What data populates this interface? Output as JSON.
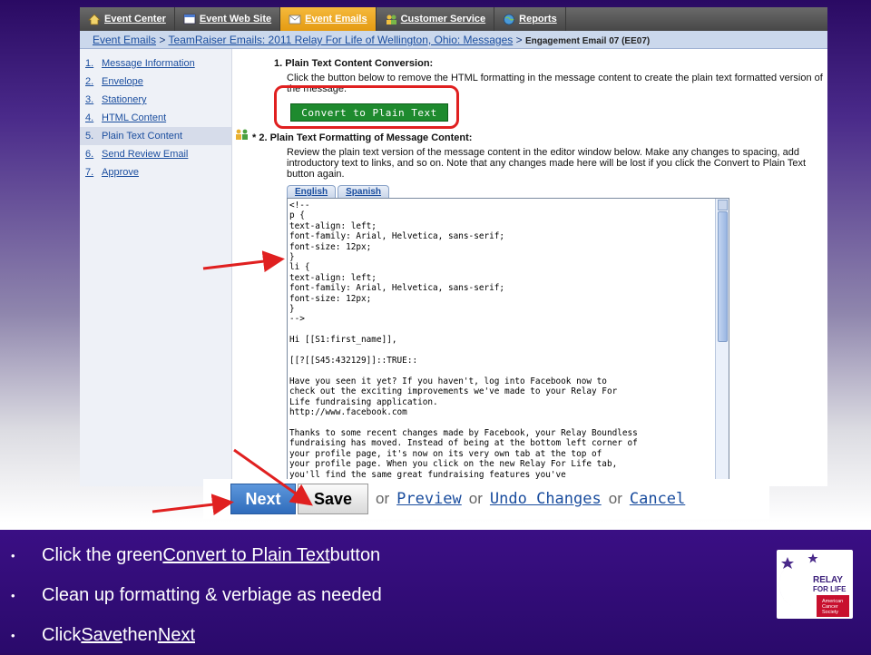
{
  "topnav": {
    "items": [
      {
        "label": "Event Center",
        "icon": "home-icon",
        "active": false
      },
      {
        "label": "Event Web Site",
        "icon": "website-icon",
        "active": false
      },
      {
        "label": "Event Emails",
        "icon": "envelope-icon",
        "active": true
      },
      {
        "label": "Customer Service",
        "icon": "people-icon",
        "active": false
      },
      {
        "label": "Reports",
        "icon": "globe-icon",
        "active": false
      }
    ]
  },
  "breadcrumb": {
    "link1": "Event Emails",
    "sep": ">",
    "link2": "TeamRaiser Emails: 2011 Relay For Life of Wellington, Ohio: Messages",
    "current": "Engagement Email 07 (EE07)"
  },
  "sidebar": {
    "steps": [
      {
        "num": "1.",
        "label": "Message Information"
      },
      {
        "num": "2.",
        "label": "Envelope"
      },
      {
        "num": "3.",
        "label": "Stationery"
      },
      {
        "num": "4.",
        "label": "HTML Content"
      },
      {
        "num": "5.",
        "label": "Plain Text Content"
      },
      {
        "num": "6.",
        "label": "Send Review Email"
      },
      {
        "num": "7.",
        "label": "Approve"
      }
    ]
  },
  "section1": {
    "title": "1.  Plain Text Content Conversion:",
    "text": "Click the button below to remove the HTML formatting in the message content to create the plain text formatted version of the message.",
    "button": "Convert to Plain Text"
  },
  "section2": {
    "title": "* 2.  Plain Text Formatting of Message Content:",
    "text": "Review the plain text version of the message content in the editor window below. Make any changes to spacing, add introductory text to links, and so on. Note that any changes made here will be lost if you click the Convert to Plain Text button again.",
    "tabs": [
      "English",
      "Spanish"
    ]
  },
  "editor": {
    "content": "<!--\np {\ntext-align: left;\nfont-family: Arial, Helvetica, sans-serif;\nfont-size: 12px;\n}\nli {\ntext-align: left;\nfont-family: Arial, Helvetica, sans-serif;\nfont-size: 12px;\n}\n-->\n\nHi [[S1:first_name]],\n\n[[?[[S45:432129]]::TRUE::\n\nHave you seen it yet? If you haven't, log into Facebook now to\ncheck out the exciting improvements we've made to your Relay For\nLife fundraising application.\nhttp://www.facebook.com\n\nThanks to some recent changes made by Facebook, your Relay Boundless\nfundraising has moved. Instead of being at the bottom left corner of\nyour profile page, it's now on its very own tab at the top of\nyour profile page. When you click on the new Relay For Life tab,\nyou'll find the same great fundraising features you've\nalways had, plus some exciting new ones that will allow you to:"
  },
  "actions": {
    "next": "Next",
    "save": "Save",
    "or": "or",
    "preview": "Preview",
    "undo": "Undo Changes",
    "cancel": "Cancel"
  },
  "bullets": {
    "b1_pre": "Click the green ",
    "b1_link": "Convert to Plain Text",
    "b1_post": " button",
    "b2": "Clean up formatting & verbiage as needed",
    "b3_pre": "Click ",
    "b3_save": "Save",
    "b3_mid": " then ",
    "b3_next": "Next"
  },
  "logo": {
    "line1": "RELAY",
    "line2": "FOR LIFE",
    "org1": "American",
    "org2": "Cancer",
    "org3": "Society"
  },
  "colors": {
    "accent_red": "#e02020",
    "convert_green": "#1e8a2e",
    "next_blue": "#2f6cbc",
    "panel_purple": "#3a0f84",
    "nav_active": "#e49b12"
  }
}
